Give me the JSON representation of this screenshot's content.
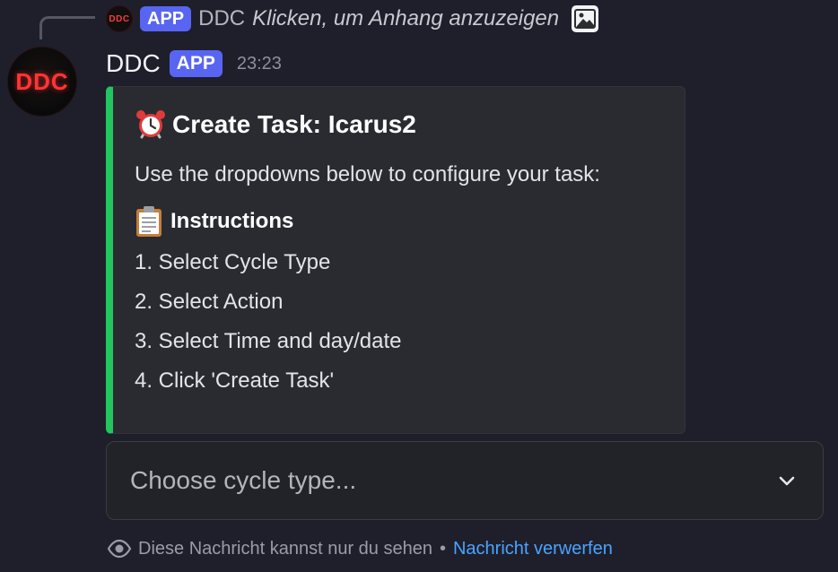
{
  "reply": {
    "avatar_text": "DDC",
    "app_tag": "APP",
    "author": "DDC",
    "text": "Klicken, um Anhang anzuzeigen",
    "icon": "image-icon"
  },
  "message": {
    "avatar_text": "DDC",
    "author": "DDC",
    "app_tag": "APP",
    "timestamp": "23:23",
    "embed": {
      "accent_color": "#22c55e",
      "title_icon": "alarm-clock-icon",
      "title": "Create Task: Icarus2",
      "description": "Use the dropdowns below to configure your task:",
      "instructions_icon": "clipboard-icon",
      "instructions_heading": "Instructions",
      "steps": [
        "1. Select Cycle Type",
        "2. Select Action",
        "3. Select Time and day/date",
        "4. Click 'Create Task'"
      ]
    },
    "select": {
      "placeholder": "Choose cycle type...",
      "icon": "chevron-down-icon"
    },
    "footer": {
      "icon": "eye-icon",
      "text": "Diese Nachricht kannst nur du sehen",
      "separator": "•",
      "link": "Nachricht verwerfen"
    }
  },
  "colors": {
    "background": "#1e1f2b",
    "app_tag": "#5865f2",
    "embed_accent": "#22c55e",
    "link": "#4aa3ff"
  }
}
